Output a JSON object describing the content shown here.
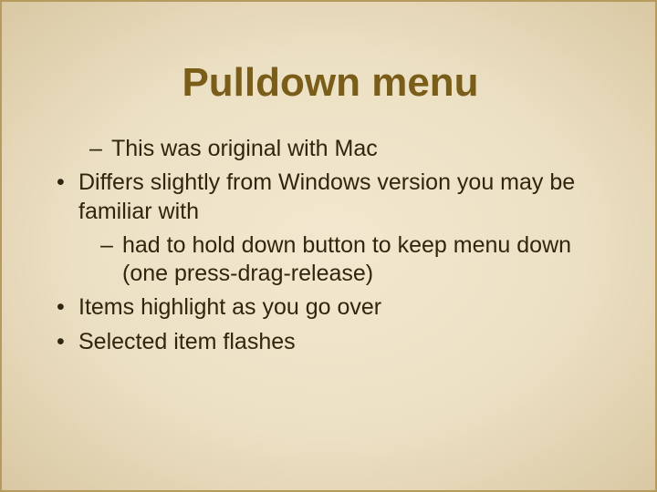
{
  "title": "Pulldown menu",
  "items": [
    {
      "level": "l2",
      "text": "This was original with Mac"
    },
    {
      "level": "l1",
      "text": "Differs slightly from Windows version you may be familiar with"
    },
    {
      "level": "l2b",
      "text": "had to hold down button to keep menu down (one press-drag-release)"
    },
    {
      "level": "l1",
      "text": "Items highlight as you go over"
    },
    {
      "level": "l1",
      "text": "Selected item flashes"
    }
  ]
}
